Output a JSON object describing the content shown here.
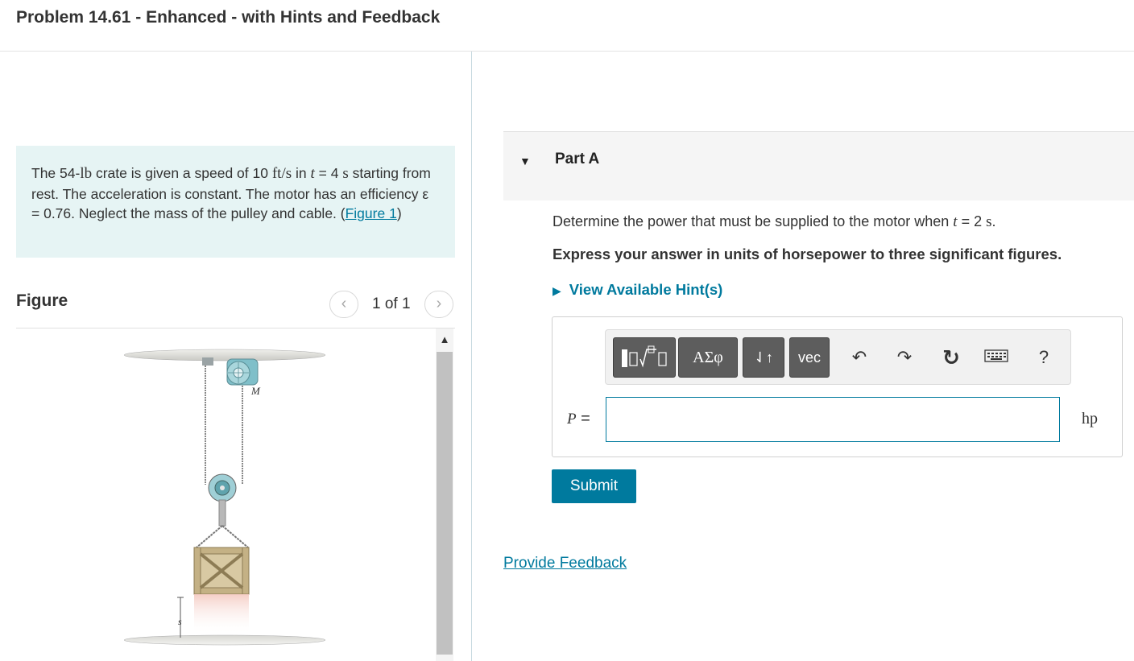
{
  "header": {
    "title": "Problem 14.61 - Enhanced - with Hints and Feedback"
  },
  "problem": {
    "text_1": "The 54-",
    "mass": "lb",
    "text_2": " crate is given a speed of 10 ",
    "speed_unit": "ft/s",
    "text_3": " in ",
    "t_var": "t",
    "text_4": " = 4 ",
    "s_unit": "s",
    "text_5": " starting from rest. The acceleration is constant. The motor has an efficiency ε = 0.76. Neglect the mass of the pulley and cable. (",
    "figure_link": "Figure 1",
    "text_6": ")"
  },
  "figure": {
    "label": "Figure",
    "pager_text": "1 of 1",
    "prev_icon": "‹",
    "next_icon": "›",
    "motor_label": "M",
    "distance_label": "s"
  },
  "part_a": {
    "label": "Part A",
    "question_1": "Determine the power that must be supplied to the motor when ",
    "question_t": "t",
    "question_2": " = 2 ",
    "question_s": "s",
    "question_3": ".",
    "instruction": "Express your answer in units of horsepower to three significant figures.",
    "hints_label": "View Available Hint(s)",
    "answer_label": "P",
    "equals": " =",
    "answer_value": "",
    "unit": "hp",
    "submit_label": "Submit"
  },
  "toolbar": {
    "greek_label": "ΑΣφ",
    "arrows_label": "⇃↑",
    "vec_label": "vec",
    "help_label": "?"
  },
  "footer": {
    "feedback_label": "Provide Feedback"
  },
  "colors": {
    "accent": "#007a9e",
    "problem_bg": "#e6f4f4",
    "toolbar_button": "#5d5d5d"
  }
}
